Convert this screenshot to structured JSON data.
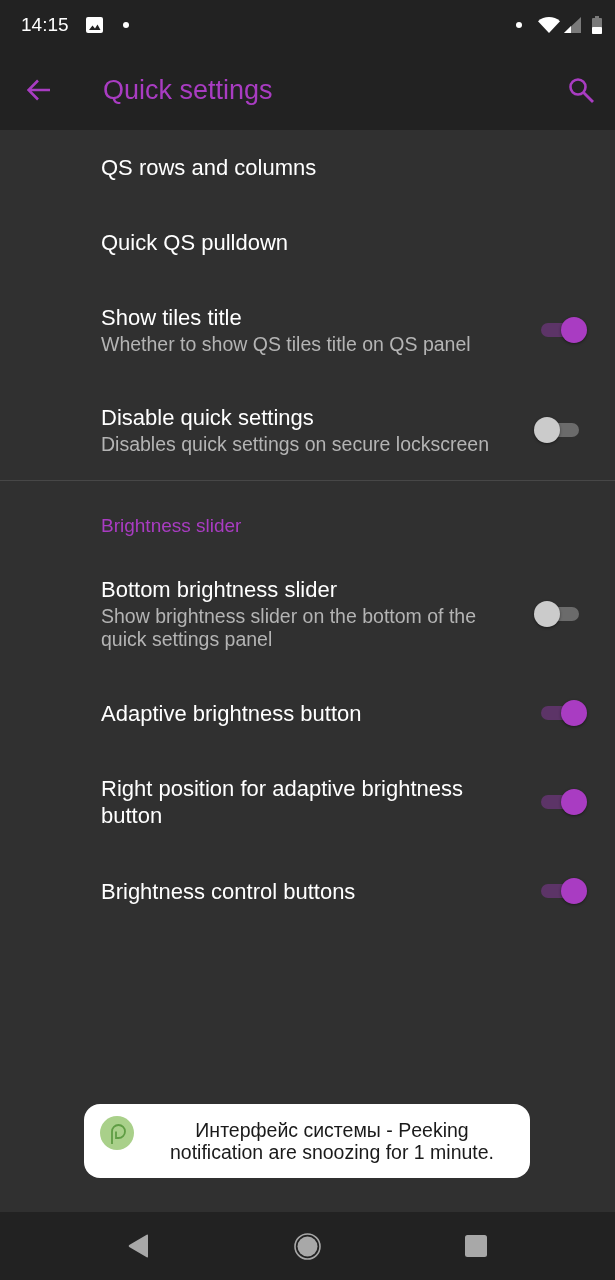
{
  "status_bar": {
    "time": "14:15"
  },
  "app_bar": {
    "title": "Quick settings"
  },
  "sections": [
    {
      "items": [
        {
          "kind": "link",
          "title": "QS rows and columns"
        },
        {
          "kind": "link",
          "title": "Quick QS pulldown"
        },
        {
          "kind": "switch",
          "title": "Show tiles title",
          "summary": "Whether to show QS tiles title on QS panel",
          "on": true
        },
        {
          "kind": "switch",
          "title": "Disable quick settings",
          "summary": "Disables quick settings on secure lockscreen",
          "on": false
        }
      ]
    },
    {
      "title": "Brightness slider",
      "items": [
        {
          "kind": "switch",
          "title": "Bottom brightness slider",
          "summary": "Show brightness slider on the bottom of the quick settings panel",
          "on": false
        },
        {
          "kind": "switch",
          "title": "Adaptive brightness button",
          "on": true
        },
        {
          "kind": "switch",
          "title": "Right position for adaptive brightness button",
          "on": true
        },
        {
          "kind": "switch",
          "title": "Brightness control buttons",
          "on": true
        }
      ]
    }
  ],
  "toast": {
    "text": "Интерфейс системы - Peeking notification are snoozing for 1 minute."
  }
}
